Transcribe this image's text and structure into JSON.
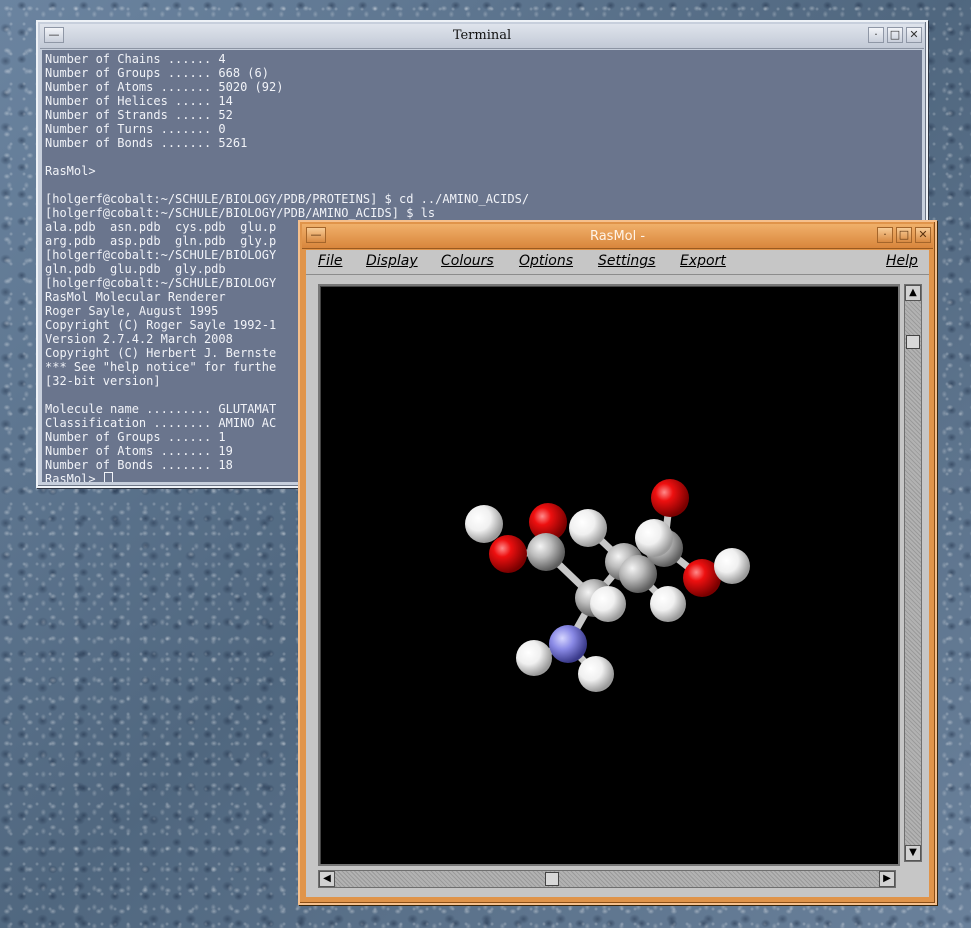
{
  "terminal": {
    "title": "Terminal",
    "lines": [
      "Number of Chains ...... 4",
      "Number of Groups ...... 668 (6)",
      "Number of Atoms ....... 5020 (92)",
      "Number of Helices ..... 14",
      "Number of Strands ..... 52",
      "Number of Turns ....... 0",
      "Number of Bonds ....... 5261",
      "",
      "RasMol>",
      "",
      "[holgerf@cobalt:~/SCHULE/BIOLOGY/PDB/PROTEINS] $ cd ../AMINO_ACIDS/",
      "[holgerf@cobalt:~/SCHULE/BIOLOGY/PDB/AMINO_ACIDS] $ ls",
      "ala.pdb  asn.pdb  cys.pdb  glu.p",
      "arg.pdb  asp.pdb  gln.pdb  gly.p",
      "[holgerf@cobalt:~/SCHULE/BIOLOGY",
      "gln.pdb  glu.pdb  gly.pdb",
      "[holgerf@cobalt:~/SCHULE/BIOLOGY",
      "RasMol Molecular Renderer",
      "Roger Sayle, August 1995",
      "Copyright (C) Roger Sayle 1992-1",
      "Version 2.7.4.2 March 2008",
      "Copyright (C) Herbert J. Bernste",
      "*** See \"help notice\" for furthe",
      "[32-bit version]",
      "",
      "Molecule name ......... GLUTAMAT",
      "Classification ........ AMINO AC",
      "Number of Groups ...... 1",
      "Number of Atoms ....... 19",
      "Number of Bonds ....... 18"
    ],
    "prompt": "RasMol>"
  },
  "rasmol": {
    "title": "RasMol -",
    "menu": [
      "File",
      "Display",
      "Colours",
      "Options",
      "Settings",
      "Export",
      "Help"
    ]
  },
  "colors": {
    "terminal_bg": "#6a758d",
    "rasmol_frame": "#e0944a",
    "oxygen": "#e00000",
    "nitrogen": "#8484e0",
    "carbon": "#b4b4b4",
    "hydrogen": "#ffffff"
  },
  "icons": [
    "window-menu-icon",
    "minimize-icon",
    "maximize-icon",
    "close-icon",
    "scroll-up-icon",
    "scroll-down-icon",
    "scroll-left-icon",
    "scroll-right-icon"
  ]
}
